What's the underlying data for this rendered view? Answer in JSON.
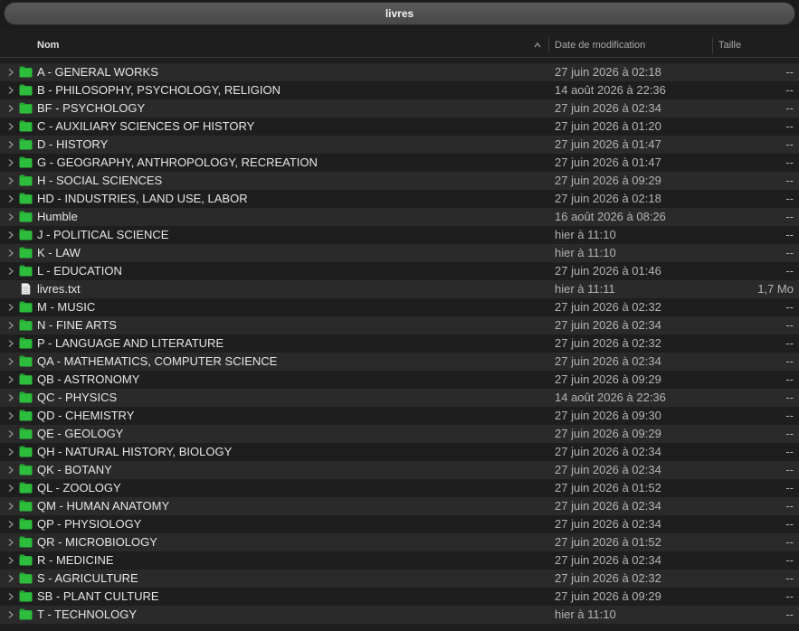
{
  "window": {
    "title": "livres"
  },
  "header": {
    "name_label": "Nom",
    "date_label": "Date de modification",
    "size_label": "Taille"
  },
  "colors": {
    "folder": "#2dbd3d",
    "folder_tab": "#25a533",
    "row_alt": "#2a2a2a",
    "row_base": "#1e1e1e"
  },
  "rows": [
    {
      "type": "folder",
      "name": "A - GENERAL WORKS",
      "date": "27 juin 2026 à 02:18",
      "size": "--"
    },
    {
      "type": "folder",
      "name": "B - PHILOSOPHY, PSYCHOLOGY, RELIGION",
      "date": "14 août 2026 à 22:36",
      "size": "--"
    },
    {
      "type": "folder",
      "name": "BF - PSYCHOLOGY",
      "date": "27 juin 2026 à 02:34",
      "size": "--"
    },
    {
      "type": "folder",
      "name": "C - AUXILIARY SCIENCES OF HISTORY",
      "date": "27 juin 2026 à 01:20",
      "size": "--"
    },
    {
      "type": "folder",
      "name": "D - HISTORY",
      "date": "27 juin 2026 à 01:47",
      "size": "--"
    },
    {
      "type": "folder",
      "name": "G - GEOGRAPHY, ANTHROPOLOGY, RECREATION",
      "date": "27 juin 2026 à 01:47",
      "size": "--"
    },
    {
      "type": "folder",
      "name": "H - SOCIAL SCIENCES",
      "date": "27 juin 2026 à 09:29",
      "size": "--"
    },
    {
      "type": "folder",
      "name": "HD - INDUSTRIES, LAND USE, LABOR",
      "date": "27 juin 2026 à 02:18",
      "size": "--"
    },
    {
      "type": "folder",
      "name": "Humble",
      "date": "16 août 2026 à 08:26",
      "size": "--"
    },
    {
      "type": "folder",
      "name": "J - POLITICAL SCIENCE",
      "date": "hier à 11:10",
      "size": "--"
    },
    {
      "type": "folder",
      "name": "K - LAW",
      "date": "hier à 11:10",
      "size": "--"
    },
    {
      "type": "folder",
      "name": "L - EDUCATION",
      "date": "27 juin 2026 à 01:46",
      "size": "--"
    },
    {
      "type": "file",
      "name": "livres.txt",
      "date": "hier à 11:11",
      "size": "1,7 Mo"
    },
    {
      "type": "folder",
      "name": "M - MUSIC",
      "date": "27 juin 2026 à 02:32",
      "size": "--"
    },
    {
      "type": "folder",
      "name": "N - FINE ARTS",
      "date": "27 juin 2026 à 02:34",
      "size": "--"
    },
    {
      "type": "folder",
      "name": "P - LANGUAGE AND LITERATURE",
      "date": "27 juin 2026 à 02:32",
      "size": "--"
    },
    {
      "type": "folder",
      "name": "QA - MATHEMATICS, COMPUTER SCIENCE",
      "date": "27 juin 2026 à 02:34",
      "size": "--"
    },
    {
      "type": "folder",
      "name": "QB - ASTRONOMY",
      "date": "27 juin 2026 à 09:29",
      "size": "--"
    },
    {
      "type": "folder",
      "name": "QC - PHYSICS",
      "date": "14 août 2026 à 22:36",
      "size": "--"
    },
    {
      "type": "folder",
      "name": "QD - CHEMISTRY",
      "date": "27 juin 2026 à 09:30",
      "size": "--"
    },
    {
      "type": "folder",
      "name": "QE - GEOLOGY",
      "date": "27 juin 2026 à 09:29",
      "size": "--"
    },
    {
      "type": "folder",
      "name": "QH - NATURAL HISTORY, BIOLOGY",
      "date": "27 juin 2026 à 02:34",
      "size": "--"
    },
    {
      "type": "folder",
      "name": "QK - BOTANY",
      "date": "27 juin 2026 à 02:34",
      "size": "--"
    },
    {
      "type": "folder",
      "name": "QL - ZOOLOGY",
      "date": "27 juin 2026 à 01:52",
      "size": "--"
    },
    {
      "type": "folder",
      "name": "QM - HUMAN ANATOMY",
      "date": "27 juin 2026 à 02:34",
      "size": "--"
    },
    {
      "type": "folder",
      "name": "QP - PHYSIOLOGY",
      "date": "27 juin 2026 à 02:34",
      "size": "--"
    },
    {
      "type": "folder",
      "name": "QR - MICROBIOLOGY",
      "date": "27 juin 2026 à 01:52",
      "size": "--"
    },
    {
      "type": "folder",
      "name": "R - MEDICINE",
      "date": "27 juin 2026 à 02:34",
      "size": "--"
    },
    {
      "type": "folder",
      "name": "S - AGRICULTURE",
      "date": "27 juin 2026 à 02:32",
      "size": "--"
    },
    {
      "type": "folder",
      "name": "SB - PLANT CULTURE",
      "date": "27 juin 2026 à 09:29",
      "size": "--"
    },
    {
      "type": "folder",
      "name": "T - TECHNOLOGY",
      "date": "hier à 11:10",
      "size": "--"
    }
  ]
}
